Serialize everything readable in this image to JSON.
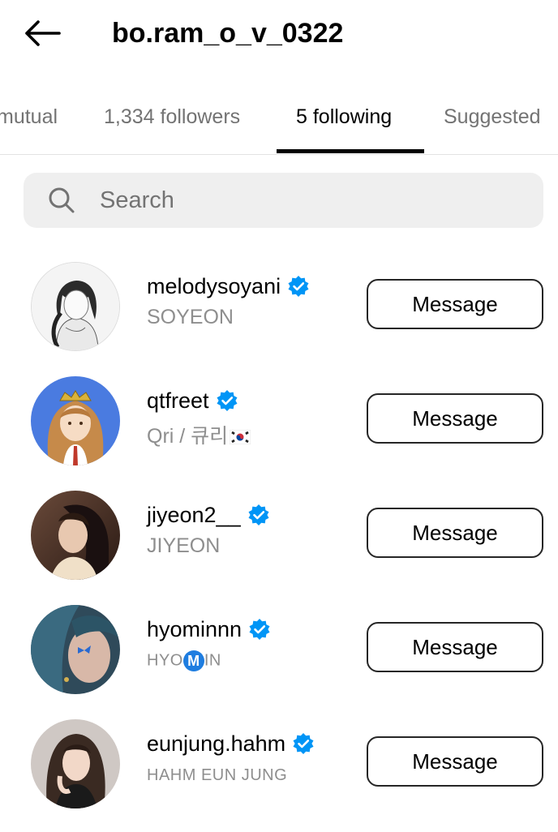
{
  "header": {
    "back_label": "Back",
    "title": "bo.ram_o_v_0322"
  },
  "tabs": [
    {
      "label": "mutual",
      "active": false
    },
    {
      "label": "1,334 followers",
      "active": false
    },
    {
      "label": "5 following",
      "active": true
    },
    {
      "label": "Suggested",
      "active": false
    }
  ],
  "search": {
    "placeholder": "Search",
    "value": ""
  },
  "accounts": [
    {
      "username": "melodysoyani",
      "verified": true,
      "full_name": "SOYEON",
      "button": "Message",
      "avatar": "sketch-portrait"
    },
    {
      "username": "qtfreet",
      "verified": true,
      "full_name": "Qri / 큐리",
      "full_name_suffix_icon": "south-korea-flag-icon",
      "button": "Message",
      "avatar": "cartoon-portrait"
    },
    {
      "username": "jiyeon2__",
      "verified": true,
      "full_name": "JIYEON",
      "button": "Message",
      "avatar": "photo-portrait"
    },
    {
      "username": "hyominnn",
      "verified": true,
      "full_name_prefix": "HYO",
      "full_name_badge": "M",
      "full_name_suffix": "IN",
      "button": "Message",
      "avatar": "photo-portrait"
    },
    {
      "username": "eunjung.hahm",
      "verified": true,
      "full_name": "HAHM EUN JUNG",
      "button": "Message",
      "avatar": "photo-portrait"
    }
  ],
  "colors": {
    "verified_blue": "#0095f6",
    "secondary_text": "#8e8e8e",
    "search_bg": "#efefef"
  }
}
